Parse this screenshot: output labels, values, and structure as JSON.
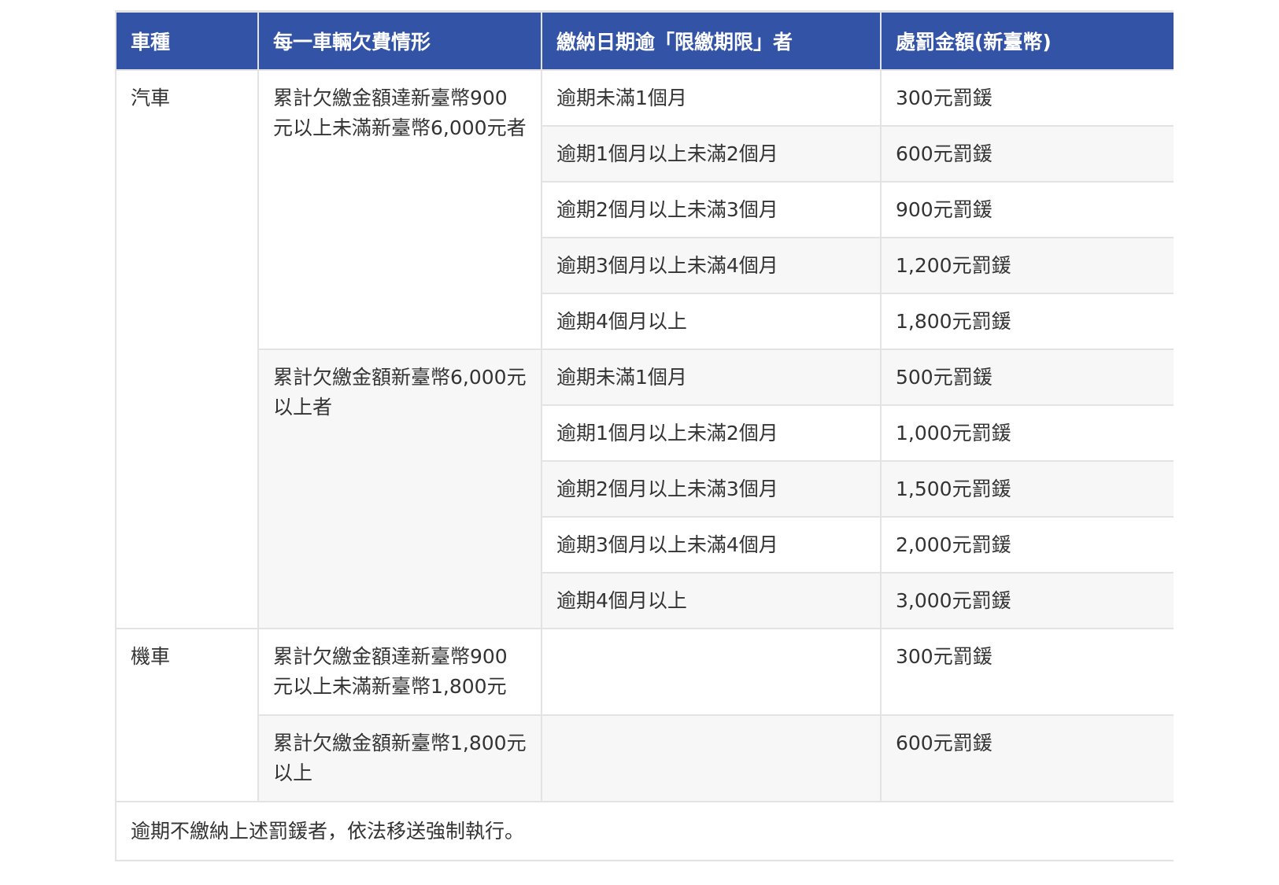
{
  "table": {
    "headers": [
      "車種",
      "每一車輛欠費情形",
      "繳納日期逾「限繳期限」者",
      "處罰金額(新臺幣)"
    ],
    "car": {
      "type": "汽車",
      "groups": [
        {
          "condition": "累計欠繳金額達新臺幣900元以上未滿新臺幣6,000元者",
          "rows": [
            {
              "overdue": "逾期未滿1個月",
              "fine": "300元罰鍰"
            },
            {
              "overdue": "逾期1個月以上未滿2個月",
              "fine": "600元罰鍰"
            },
            {
              "overdue": "逾期2個月以上未滿3個月",
              "fine": "900元罰鍰"
            },
            {
              "overdue": "逾期3個月以上未滿4個月",
              "fine": "1,200元罰鍰"
            },
            {
              "overdue": "逾期4個月以上",
              "fine": "1,800元罰鍰"
            }
          ]
        },
        {
          "condition": "累計欠繳金額新臺幣6,000元以上者",
          "rows": [
            {
              "overdue": "逾期未滿1個月",
              "fine": "500元罰鍰"
            },
            {
              "overdue": "逾期1個月以上未滿2個月",
              "fine": "1,000元罰鍰"
            },
            {
              "overdue": "逾期2個月以上未滿3個月",
              "fine": "1,500元罰鍰"
            },
            {
              "overdue": "逾期3個月以上未滿4個月",
              "fine": "2,000元罰鍰"
            },
            {
              "overdue": "逾期4個月以上",
              "fine": "3,000元罰鍰"
            }
          ]
        }
      ]
    },
    "motorcycle": {
      "type": "機車",
      "rows": [
        {
          "condition": "累計欠繳金額達新臺幣900元以上未滿新臺幣1,800元",
          "overdue": "",
          "fine": "300元罰鍰"
        },
        {
          "condition": "累計欠繳金額新臺幣1,800元以上",
          "overdue": "",
          "fine": "600元罰鍰"
        }
      ]
    },
    "note": "逾期不繳納上述罰鍰者，依法移送強制執行。"
  }
}
